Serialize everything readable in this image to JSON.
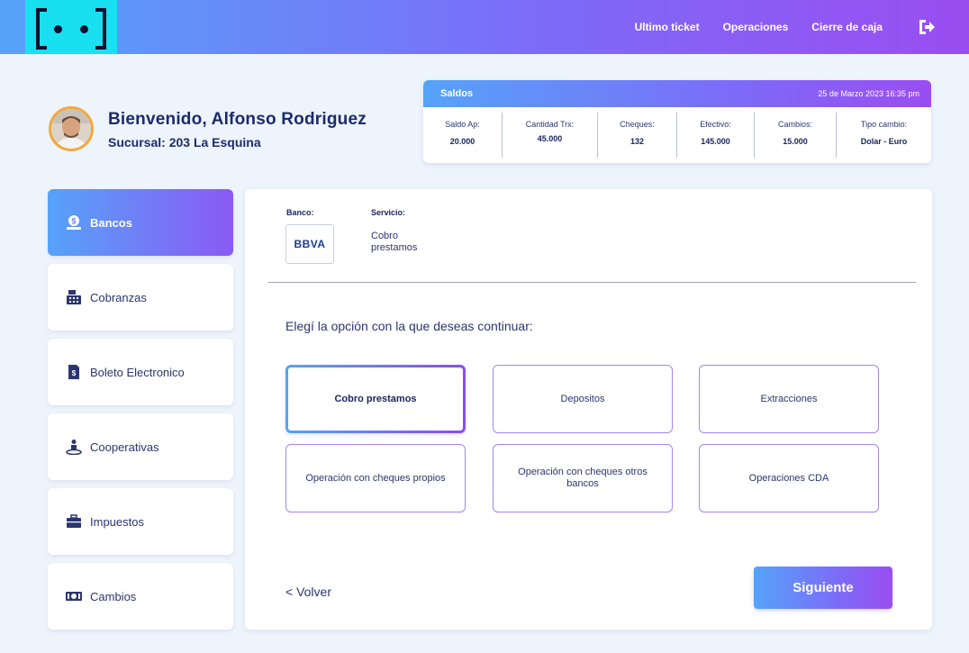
{
  "nav": {
    "items": [
      "Ultimo ticket",
      "Operaciones",
      "Cierre de caja"
    ],
    "logout_icon": "logout-icon"
  },
  "welcome": {
    "greeting": "Bienvenido, Alfonso Rodriguez",
    "branch": "Sucursal: 203 La Esquina"
  },
  "saldos": {
    "title": "Saldos",
    "datetime": "25 de Marzo 2023 16:35 pm",
    "columns": [
      {
        "label": "Saldo Ap:",
        "value": "20.000"
      },
      {
        "label": "Cantidad Trx:",
        "value": "45.000"
      },
      {
        "label": "Cheques:",
        "value": "132"
      },
      {
        "label": "Efectivo:",
        "value": "145.000"
      },
      {
        "label": "Cambios:",
        "value": "15.000"
      },
      {
        "label": "Tipo cambio:",
        "value": "Dolar - Euro"
      }
    ]
  },
  "sidebar": {
    "items": [
      {
        "label": "Bancos",
        "icon": "bank-money-icon",
        "active": true
      },
      {
        "label": "Cobranzas",
        "icon": "cash-register-icon",
        "active": false
      },
      {
        "label": "Boleto Electronico",
        "icon": "ticket-document-icon",
        "active": false
      },
      {
        "label": "Cooperativas",
        "icon": "person-icon",
        "active": false
      },
      {
        "label": "Impuestos",
        "icon": "briefcase-icon",
        "active": false
      },
      {
        "label": "Cambios",
        "icon": "banknote-icon",
        "active": false
      }
    ]
  },
  "main": {
    "bank_label": "Banco:",
    "bank_name": "BBVA",
    "service_label": "Servicio:",
    "service_value": "Cobro prestamos",
    "prompt": "Elegí la opción con la que deseas continuar:",
    "options": [
      {
        "label": "Cobro prestamos",
        "selected": true
      },
      {
        "label": "Depositos",
        "selected": false
      },
      {
        "label": "Extracciones",
        "selected": false
      },
      {
        "label": "Operación con cheques propios",
        "selected": false
      },
      {
        "label": "Operación con cheques otros bancos",
        "selected": false
      },
      {
        "label": "Operaciones CDA",
        "selected": false
      }
    ],
    "back_label": "< Volver",
    "next_label": "Siguiente"
  },
  "colors": {
    "gradient_start": "#56a3f9",
    "gradient_end": "#9a4df2",
    "logo_bg": "#18e0f0",
    "text_dark": "#1c2b6e",
    "avatar_ring": "#f2a93b"
  }
}
